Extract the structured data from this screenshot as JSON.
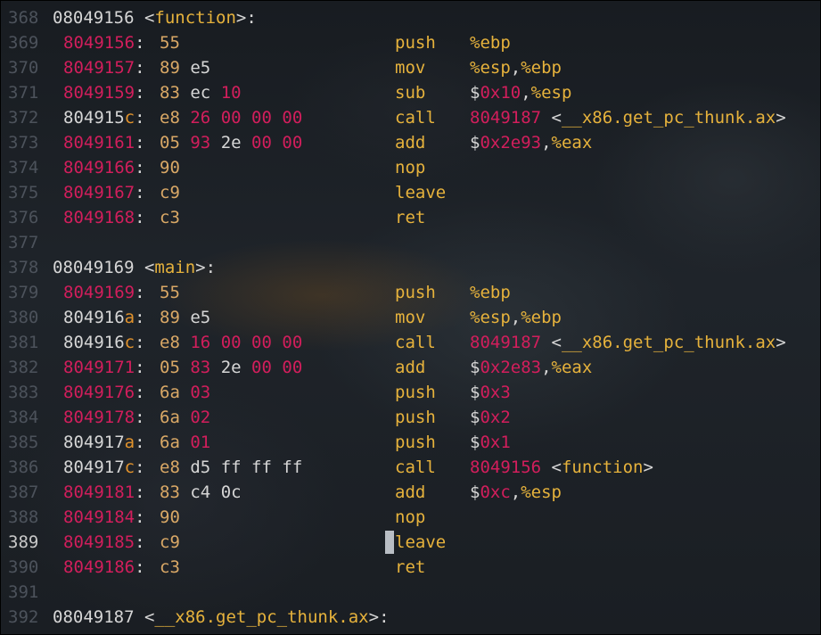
{
  "lines": [
    {
      "n": "368",
      "type": "header",
      "addr": "08049156",
      "name": "function"
    },
    {
      "n": "369",
      "type": "instr",
      "addr": "8049156",
      "bytes": [
        "55"
      ],
      "mn": "push",
      "ops": "%ebp"
    },
    {
      "n": "370",
      "type": "instr",
      "addr": "8049157",
      "bytes": [
        "89",
        "e5"
      ],
      "mn": "mov",
      "ops": "%esp,%ebp"
    },
    {
      "n": "371",
      "type": "instr",
      "addr": "8049159",
      "bytes": [
        "83",
        "ec",
        "10"
      ],
      "mn": "sub",
      "ops": "$0x10,%esp"
    },
    {
      "n": "372",
      "type": "instr",
      "addr": "804915c",
      "bytes": [
        "e8",
        "26",
        "00",
        "00",
        "00"
      ],
      "mn": "call",
      "ops": "8049187 <__x86.get_pc_thunk.ax>"
    },
    {
      "n": "373",
      "type": "instr",
      "addr": "8049161",
      "bytes": [
        "05",
        "93",
        "2e",
        "00",
        "00"
      ],
      "mn": "add",
      "ops": "$0x2e93,%eax"
    },
    {
      "n": "374",
      "type": "instr",
      "addr": "8049166",
      "bytes": [
        "90"
      ],
      "mn": "nop",
      "ops": ""
    },
    {
      "n": "375",
      "type": "instr",
      "addr": "8049167",
      "bytes": [
        "c9"
      ],
      "mn": "leave",
      "ops": ""
    },
    {
      "n": "376",
      "type": "instr",
      "addr": "8049168",
      "bytes": [
        "c3"
      ],
      "mn": "ret",
      "ops": ""
    },
    {
      "n": "377",
      "type": "blank"
    },
    {
      "n": "378",
      "type": "header",
      "addr": "08049169",
      "name": "main"
    },
    {
      "n": "379",
      "type": "instr",
      "addr": "8049169",
      "bytes": [
        "55"
      ],
      "mn": "push",
      "ops": "%ebp"
    },
    {
      "n": "380",
      "type": "instr",
      "addr": "804916a",
      "bytes": [
        "89",
        "e5"
      ],
      "mn": "mov",
      "ops": "%esp,%ebp"
    },
    {
      "n": "381",
      "type": "instr",
      "addr": "804916c",
      "bytes": [
        "e8",
        "16",
        "00",
        "00",
        "00"
      ],
      "mn": "call",
      "ops": "8049187 <__x86.get_pc_thunk.ax>"
    },
    {
      "n": "382",
      "type": "instr",
      "addr": "8049171",
      "bytes": [
        "05",
        "83",
        "2e",
        "00",
        "00"
      ],
      "mn": "add",
      "ops": "$0x2e83,%eax"
    },
    {
      "n": "383",
      "type": "instr",
      "addr": "8049176",
      "bytes": [
        "6a",
        "03"
      ],
      "mn": "push",
      "ops": "$0x3"
    },
    {
      "n": "384",
      "type": "instr",
      "addr": "8049178",
      "bytes": [
        "6a",
        "02"
      ],
      "mn": "push",
      "ops": "$0x2"
    },
    {
      "n": "385",
      "type": "instr",
      "addr": "804917a",
      "bytes": [
        "6a",
        "01"
      ],
      "mn": "push",
      "ops": "$0x1"
    },
    {
      "n": "386",
      "type": "instr",
      "addr": "804917c",
      "bytes": [
        "e8",
        "d5",
        "ff",
        "ff",
        "ff"
      ],
      "mn": "call",
      "ops": "8049156 <function>"
    },
    {
      "n": "387",
      "type": "instr",
      "addr": "8049181",
      "bytes": [
        "83",
        "c4",
        "0c"
      ],
      "mn": "add",
      "ops": "$0xc,%esp"
    },
    {
      "n": "388",
      "type": "instr",
      "addr": "8049184",
      "bytes": [
        "90"
      ],
      "mn": "nop",
      "ops": ""
    },
    {
      "n": "389",
      "type": "instr",
      "addr": "8049185",
      "bytes": [
        "c9"
      ],
      "mn": "leave",
      "ops": "",
      "cursor": true
    },
    {
      "n": "390",
      "type": "instr",
      "addr": "8049186",
      "bytes": [
        "c3"
      ],
      "mn": "ret",
      "ops": ""
    },
    {
      "n": "391",
      "type": "blank"
    },
    {
      "n": "392",
      "type": "header",
      "addr": "08049187",
      "name": "__x86.get_pc_thunk.ax"
    }
  ],
  "colors": {
    "address": "#d21e5c",
    "mnemonic": "#e6b23c",
    "plain": "#d6d6d6",
    "line_number": "#4c525b"
  }
}
